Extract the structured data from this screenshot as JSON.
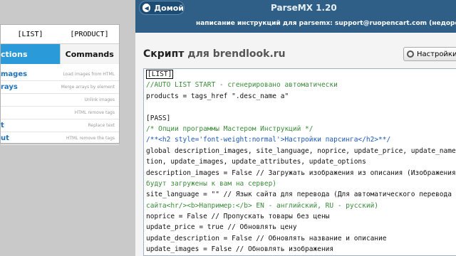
{
  "left_panel": {
    "headers": [
      "[LIST]",
      "[PRODUCT]"
    ],
    "tabs": [
      "ctions",
      "Commands"
    ],
    "items": [
      {
        "name": "mages",
        "desc": "Load images from HTML"
      },
      {
        "name": "rays",
        "desc": "Merge arrays by element"
      },
      {
        "name": "",
        "desc": "Unlink images"
      },
      {
        "name": "",
        "desc": "HTML remove tags"
      },
      {
        "name": "t",
        "desc": "Replace text"
      },
      {
        "name": "ut",
        "desc": "HTML remove the tags"
      }
    ]
  },
  "header": {
    "home_label": "Домой",
    "app_title": "ParseMX 1.20",
    "subtitle": "написание инструкций для parsemx: support@ruopencart.com (недорого!)"
  },
  "script": {
    "title": "Скрипт",
    "site": "для brendlook.ru",
    "settings_label": "Настройки"
  },
  "code_lines": [
    {
      "text": "[LIST]",
      "cls": "cursor"
    },
    {
      "text": "//AUTO LIST START - сгенерировано автоматически",
      "cls": "cmt"
    },
    {
      "text": "products = tags_href \".desc_name a\"",
      "cls": ""
    },
    {
      "text": "",
      "cls": ""
    },
    {
      "text": "[PASS]",
      "cls": ""
    },
    {
      "text": "/* Опции программы Мастером Инструкций */",
      "cls": "cmt"
    },
    {
      "text": "/**<h2 style='font-weight:normal'>Настройки парсинга</h2>**/",
      "cls": "kw"
    },
    {
      "text": "global description_images, site_language, noprice, update_price, update_name, upd",
      "cls": ""
    },
    {
      "text": "tion, update_images, update_attributes, update_options",
      "cls": ""
    },
    {
      "text": "description_images = False // Загружать изображения из описания (Изображения из о",
      "cls": ""
    },
    {
      "text": "будут загружены к вам на сервер)",
      "cls": "cmt"
    },
    {
      "text": "site_language = \"\" // Язык сайта для перевода (Для автоматического перевода устан",
      "cls": ""
    },
    {
      "text": "сайта<hr/><b>Например:</b> EN - английский, RU - русский)",
      "cls": "cmt"
    },
    {
      "text": "noprice = False // Пропускать товары без цены",
      "cls": ""
    },
    {
      "text": "update_price = true // Обновлять цену",
      "cls": ""
    },
    {
      "text": "update_description = False // Обновлять название и описание",
      "cls": ""
    },
    {
      "text": "update_images = False // Обновлять изображения",
      "cls": ""
    }
  ]
}
